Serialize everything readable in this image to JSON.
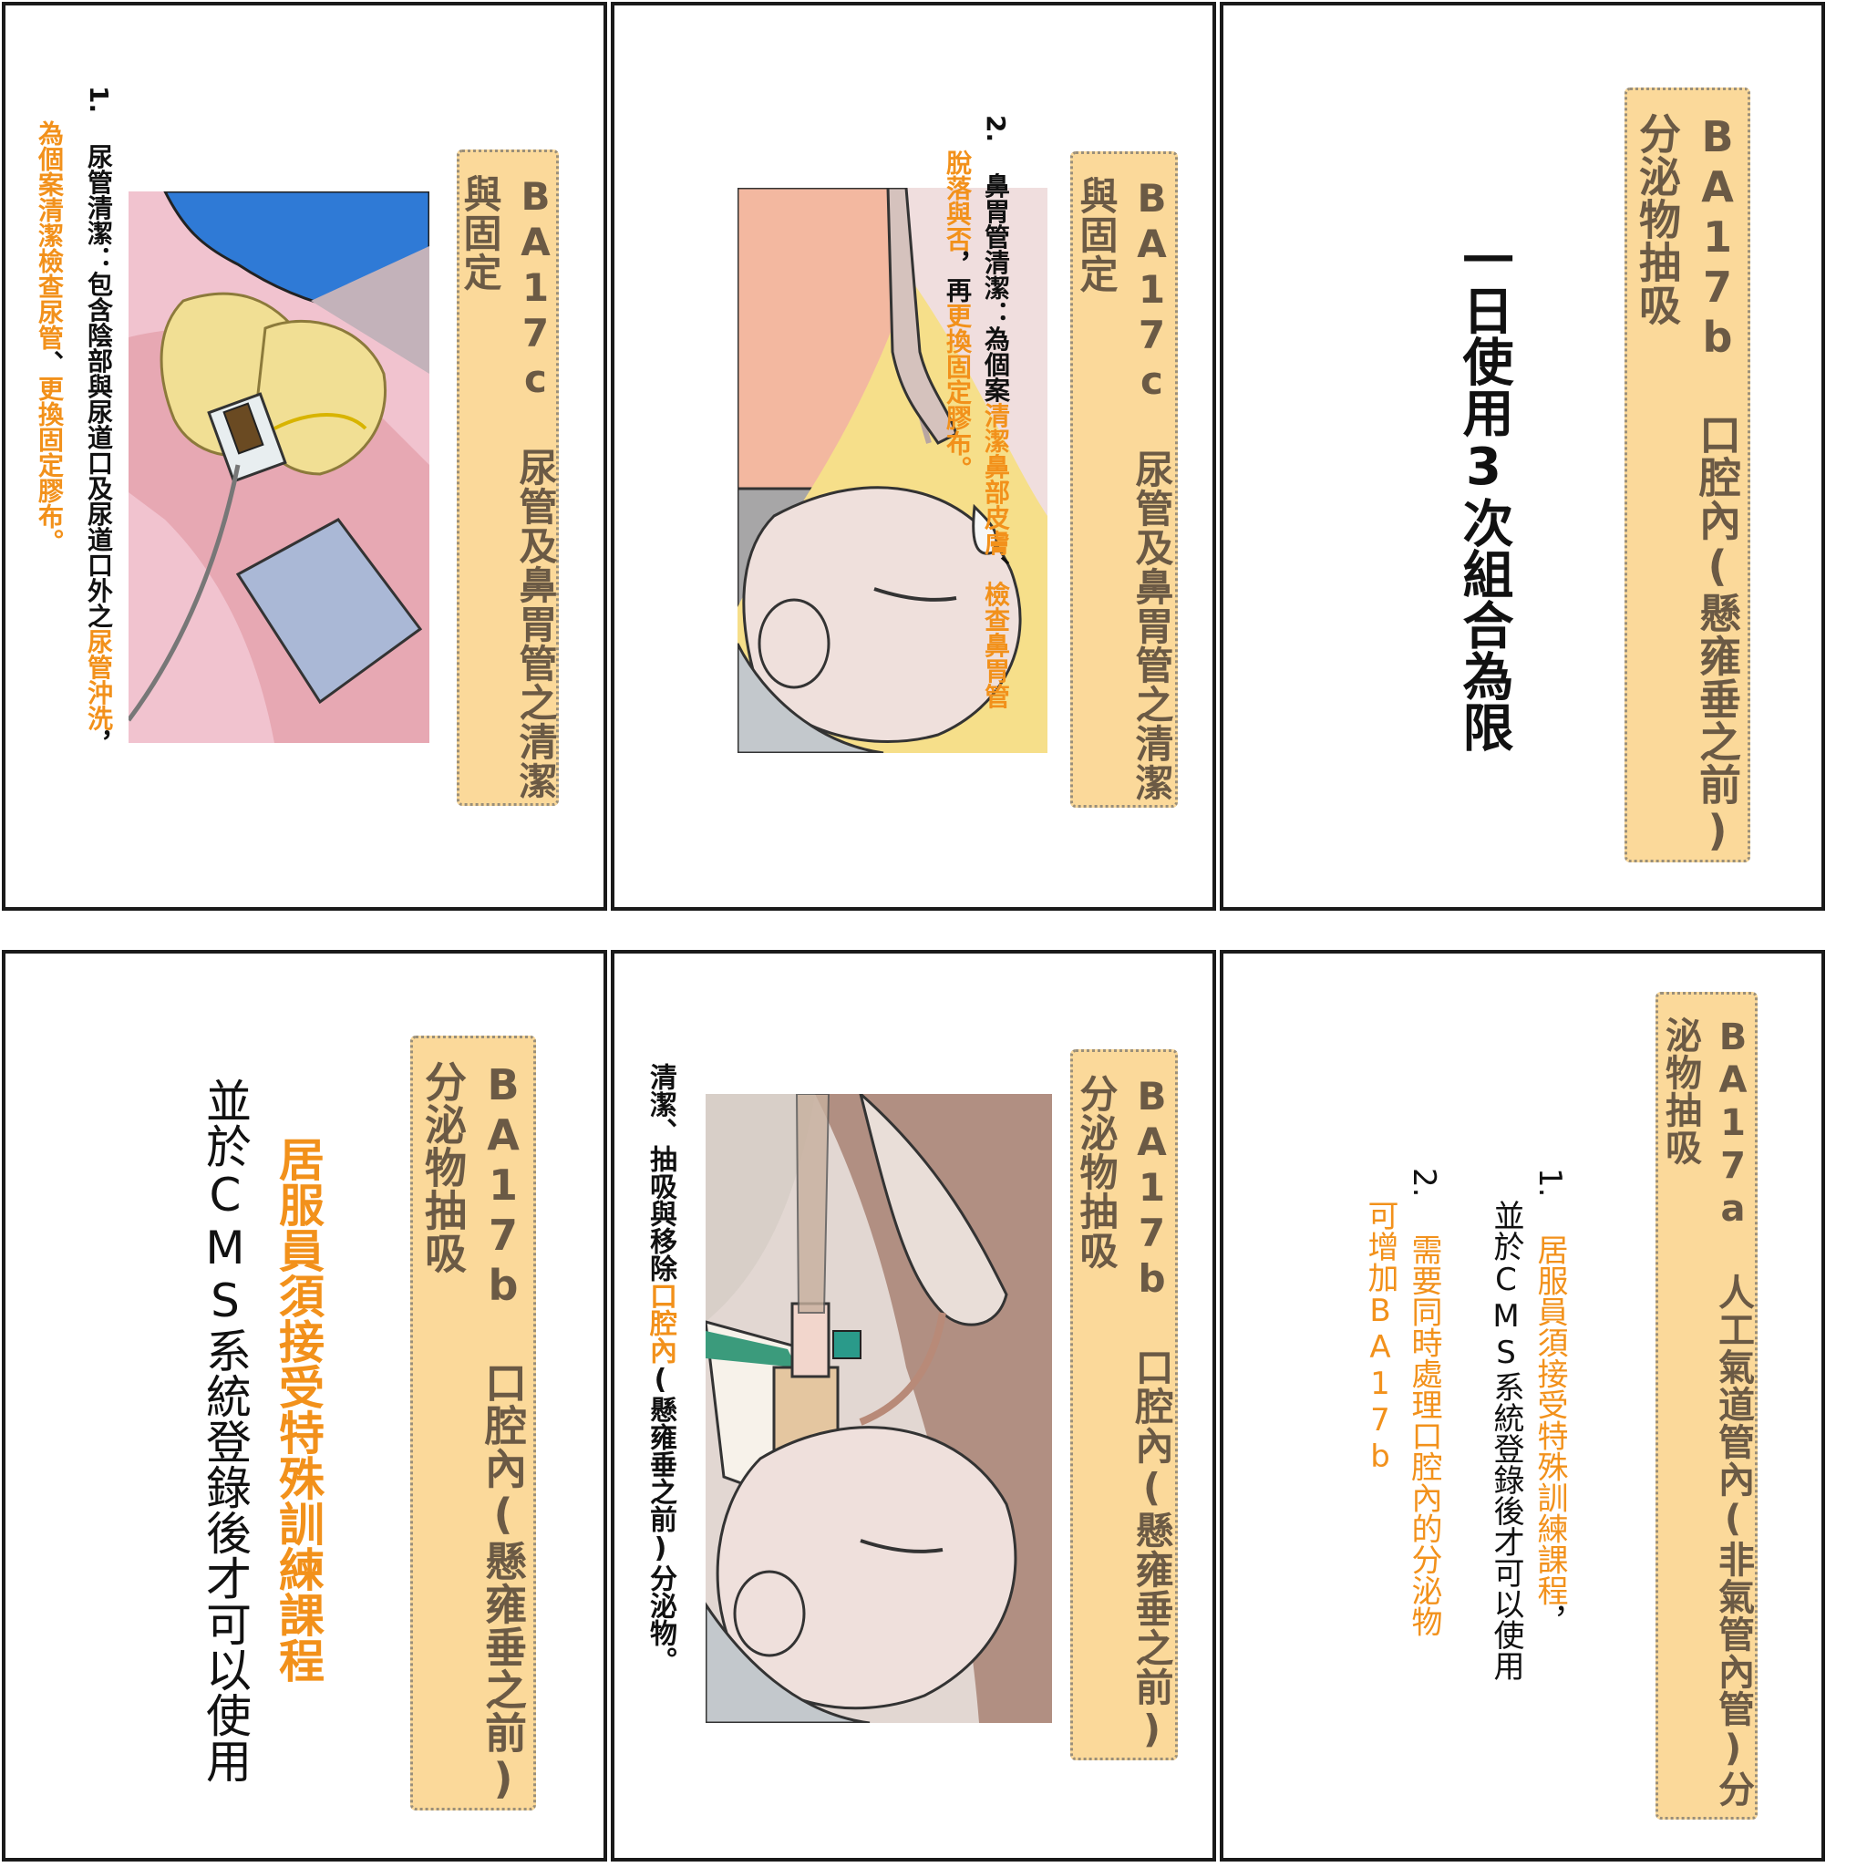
{
  "colors": {
    "accent": "#f2911b",
    "title_bg": "#fbd99a",
    "title_text": "#6b5a45",
    "border": "#1a1a1a"
  },
  "panels": {
    "top_right": {
      "title": "BA17b 口腔內(懸雍垂之前)分泌物抽吸",
      "body": "一日使用3次組合為限"
    },
    "top_middle": {
      "title": "BA17c 尿管及鼻胃管之清潔與固定",
      "line1_num": "2.",
      "line1_label": "鼻胃管清潔：",
      "line1_text": "為個案",
      "line1_orange": "清潔鼻部皮膚",
      "line1_sep": "、",
      "line1_orange2": "檢查鼻胃管",
      "line2_orange": "脫落與否",
      "line2_text": "，再",
      "line2_orange2": "更換固定膠布",
      "line2_end": "。"
    },
    "top_left": {
      "title": "BA17c 尿管及鼻胃管之清潔與固定",
      "line1_num": "1.",
      "line1_label": "尿管清潔：",
      "line1_text": "包含陰部與尿道口及尿道口外之",
      "line1_orange": "尿管沖洗",
      "line1_end": "，",
      "line2_orange": "為個案清潔檢查尿管",
      "line2_sep": "、",
      "line2_orange2": "更換固定膠布",
      "line2_end": "。"
    },
    "bottom_right": {
      "title": "BA17a 人工氣道管內(非氣管內管)分泌物抽吸",
      "item1_num": "1.",
      "item1_orange": "居服員須接受特殊訓練課程",
      "item1_end": "，",
      "item1_line2": "並於CMS系統登錄後才可以使用",
      "item2_num": "2.",
      "item2_orange": "需要同時處理口腔內的分泌物",
      "item2_line2": "可增加BA17b"
    },
    "bottom_middle": {
      "title": "BA17b 口腔內(懸雍垂之前)分泌物抽吸",
      "text_pre": "清潔、抽吸與移除",
      "text_orange": "口腔內",
      "text_post": "(懸雍垂之前)分泌物。"
    },
    "bottom_left": {
      "title": "BA17b 口腔內(懸雍垂之前)分泌物抽吸",
      "line1": "居服員須接受特殊訓練課程",
      "line2": "並於CMS系統登錄後才可以使用"
    }
  }
}
